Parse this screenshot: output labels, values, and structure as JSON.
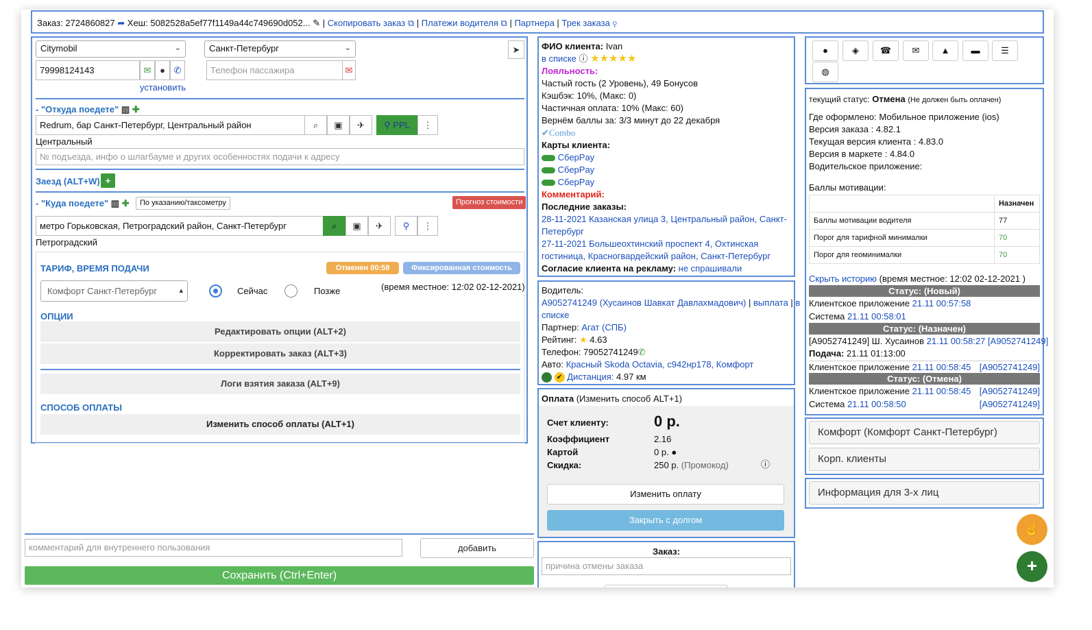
{
  "header": {
    "order_label": "Заказ: 2724860827",
    "hash_label": "Хеш: 5082528a5ef77f1149a44c749690d052...",
    "sep1": " | ",
    "copy_link": "Скопировать заказ",
    "sep2": " | ",
    "payments_link": "Платежи водителя",
    "sep3": " | ",
    "partner_link": "Партнера",
    "sep4": " | ",
    "track_link": "Трек заказа"
  },
  "left": {
    "service_select": "Citymobil",
    "city_select": "Санкт-Петербург",
    "phone_value": "79998124143",
    "phone_set_link": "установить",
    "passenger_phone_placeholder": "Телефон пассажира",
    "from_title": "- \"Откуда поедете\"",
    "from_value": "Redrum, бар Санкт-Петербург, Центральный район",
    "from_district": "Центральный",
    "ppl_label": "PPL",
    "entrance_placeholder": "№ подъезда, инфо о шлагбауме и других особенностях подачи к адресу",
    "stop_title": "Заезд (ALT+W)",
    "to_title": "- \"Куда поедете\"",
    "by_meter_button": "По указанию/таксометру",
    "forecast_button": "Прогноз стоимости",
    "to_value": "метро Горьковская, Петроградский район, Санкт-Петербург",
    "to_district": "Петроградский",
    "tariff_title": "ТАРИФ, ВРЕМЯ ПОДАЧИ",
    "cancelled_badge": "Отменен 00:58",
    "fixed_badge": "Фиксированная стоимость",
    "tariff_select": "Комфорт Санкт-Петербург",
    "now_label": "Сейчас",
    "later_label": "Позже",
    "local_time": "(время местное: 12:02 02-12-2021)",
    "options_title": "ОПЦИИ",
    "edit_options": "Редактировать опции (ALT+2)",
    "correct_order": "Корректировать заказ (ALT+3)",
    "logs": "Логи взятия заказа (ALT+9)",
    "payment_title": "СПОСОБ ОПЛАТЫ",
    "change_payment": "Изменить способ оплаты (ALT+1)",
    "comment_placeholder": "комментарий для внутреннего пользования",
    "add_button": "добавить",
    "save_button": "Сохранить (Ctrl+Enter)"
  },
  "client": {
    "name_label": "ФИО клиента:",
    "name_value": " Ivan",
    "in_list": "в списке",
    "stars": "★★★★★",
    "loyalty_label": "Лояльность:",
    "loyalty_lines": [
      "Частый гость (2 Уровень), 49 Бонусов",
      "Кэшбэк: 10%, (Макс: 0)",
      "Частичная оплата: 10% (Макс: 60)",
      "Вернём баллы за: 3/3 минут до 22 декабря"
    ],
    "combo": "Combo",
    "cards_label": "Карты клиента:",
    "cards": [
      "СберPay",
      "СберPay",
      "СберPay"
    ],
    "comment_label": "Комментарий:",
    "last_orders_label": "Последние заказы:",
    "orders": [
      "28-11-2021 Казанская улица 3, Центральный район, Санкт-",
      "Петербург",
      "27-11-2021 Большеохтинский проспект 4, Охтинская",
      "гостиница, Красногвардейский район, Санкт-Петербург"
    ],
    "consent_label": "Согласие клиента на рекламу:",
    "consent_value": "не спрашивали"
  },
  "driver": {
    "label": "Водитель:",
    "driver_link": "А9052741249 (Хусаинов Шавкат Давлахмадович)",
    "sep": " | ",
    "payout_link": "выплата",
    "in_list_link": "в",
    "in_list_link2": "списке",
    "partner_label": "Партнер:",
    "partner_link": "Агат (СПБ)",
    "rating_label": "Рейтинг:",
    "rating_value": "4.63",
    "phone_label": "Телефон:",
    "phone_value": "79052741249",
    "car_label": "Авто:",
    "car_link": "Красный Skoda Octavia, с942нр178, Комфорт",
    "distance_link": "Дистанция:",
    "distance_value": "4.97 км"
  },
  "payment": {
    "title": "Оплата",
    "title_link": "(Изменить способ ALT+1)",
    "bill_label": "Счет клиенту:",
    "bill_value": "0 р.",
    "coef_label": "Коэффициент",
    "coef_value": "2.16",
    "card_label": "Картой",
    "card_value": "0 р.",
    "discount_label": "Скидка:",
    "discount_value": "250 р.",
    "discount_note": "(Промокод)",
    "change_button": "Изменить оплату",
    "close_debt_button": "Закрыть с долгом"
  },
  "order_cancel": {
    "title": "Заказ:",
    "reason_placeholder": "причина отмены заказа"
  },
  "status": {
    "current_label": "текущий статус:",
    "current_value": "Отмена",
    "current_note": "(Не должен быть оплачен)",
    "source": "Где оформлено: Мобильное приложение (ios)",
    "order_version": "Версия заказа : 4.82.1",
    "client_version": "Текущая версия клиента : 4.83.0",
    "market_version": "Версия в маркете : 4.84.0",
    "driver_app": "Водительское приложение:",
    "motivation_title": "Баллы мотивации:",
    "motivation_header": "Назначен",
    "motivation_rows": [
      {
        "name": "Баллы мотивации водителя",
        "value": "77"
      },
      {
        "name": "Порог для тарифной минималки",
        "value": "70"
      },
      {
        "name": "Порог для геоминималки",
        "value": "70"
      }
    ],
    "hide_history": "Скрыть историю",
    "history_time": " (время местное: 12:02 02-12-2021 )",
    "h_new": "Статус: (Новый)",
    "h_assigned": "Статус: (Назначен)",
    "h_cancel": "Статус: (Отмена)",
    "r1a": "Клиентское приложение",
    "r1b": "21.11 00:57:58",
    "r2a": "Система",
    "r2b": "21.11 00:58:01",
    "r3a": "[А9052741249] Ш. Хусаинов",
    "r3b": "21.11 00:58:27",
    "r3c": "[А9052741249]",
    "r4a": "Подача:",
    "r4b": " 21.11 01:13:00",
    "r5a": "Клиентское приложение",
    "r5b": "21.11 00:58:45",
    "r5c": "[А9052741249]",
    "r6a": "Клиентское приложение",
    "r6b": "21.11 00:58:45",
    "r6c": "[А9052741249]",
    "r7a": "Система",
    "r7b": "21.11 00:58:50",
    "r7c": "[А9052741249]"
  },
  "right_buttons": {
    "tariff": "Комфорт (Комфорт Санкт-Петербург)",
    "corp": "Корп. клиенты",
    "third_party": "Информация для 3-х лиц"
  }
}
